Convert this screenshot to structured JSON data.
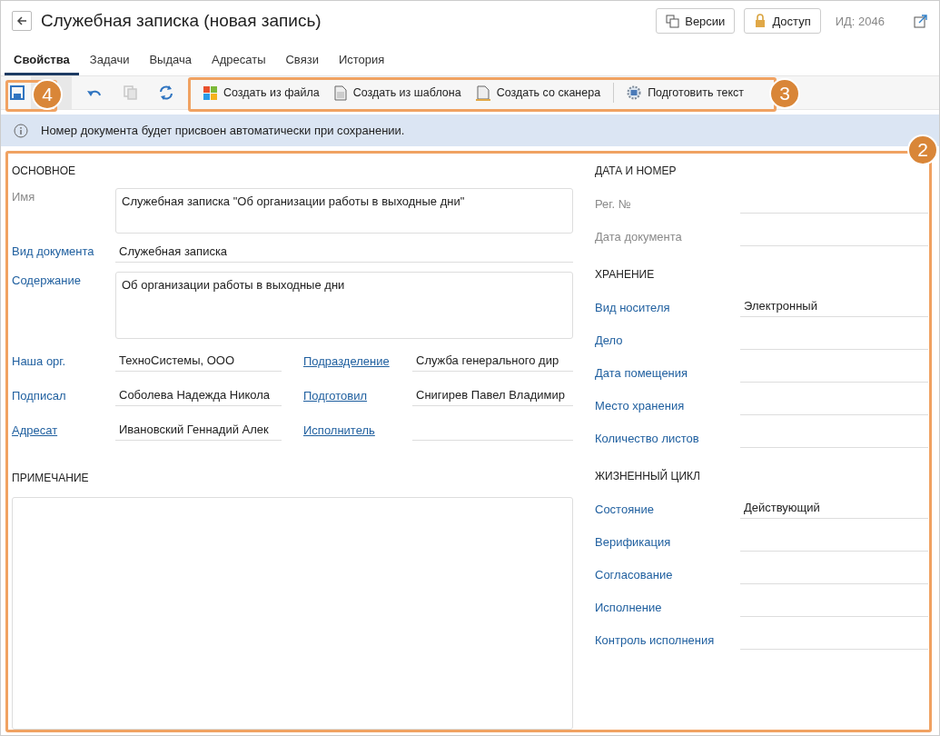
{
  "window": {
    "title": "Служебная записка (новая запись)",
    "id_label": "ИД: 2046"
  },
  "header_buttons": [
    {
      "label": "Версии",
      "kind": "versions"
    },
    {
      "label": "Доступ",
      "kind": "access"
    }
  ],
  "tabs": [
    {
      "label": "Свойства",
      "selected": true
    },
    {
      "label": "Задачи",
      "selected": false
    },
    {
      "label": "Выдача",
      "selected": false
    },
    {
      "label": "Адресаты",
      "selected": false
    },
    {
      "label": "Связи",
      "selected": false
    },
    {
      "label": "История",
      "selected": false
    }
  ],
  "toolbar": {
    "icons": [
      {
        "kind": "save",
        "disabled": false
      },
      {
        "kind": "undo",
        "disabled": false
      },
      {
        "kind": "copy",
        "disabled": true
      },
      {
        "kind": "refresh",
        "disabled": false
      }
    ],
    "actions": [
      {
        "label": "Создать из файла",
        "kind": "file"
      },
      {
        "label": "Создать из шаблона",
        "kind": "template"
      },
      {
        "label": "Создать со сканера",
        "kind": "scanner"
      },
      {
        "label": "Подготовить текст",
        "kind": "ai"
      }
    ]
  },
  "info": {
    "text": "Номер документа будет присвоен автоматически при сохранении."
  },
  "basic": {
    "title": "ОСНОВНОЕ",
    "fields": [
      {
        "label": "Имя",
        "kind": "plain",
        "multiline": true,
        "value": "Служебная записка \"Об организации работы в выходные дни\""
      },
      {
        "label": "Вид документа",
        "kind": "field",
        "multiline": false,
        "value": "Служебная записка"
      },
      {
        "label": "Содержание",
        "kind": "field",
        "multiline": true,
        "value": "Об организации работы в выходные дни"
      }
    ],
    "pairs": [
      [
        {
          "label": "Наша орг.",
          "kind": "field",
          "value": "ТехноСистемы, ООО"
        },
        {
          "label": "Подразделение",
          "kind": "link",
          "value": "Служба генерального дир"
        }
      ],
      [
        {
          "label": "Подписал",
          "kind": "field",
          "value": "Соболева Надежда Никола"
        },
        {
          "label": "Подготовил",
          "kind": "link",
          "value": "Снигирев Павел Владимир"
        }
      ],
      [
        {
          "label": "Адресат",
          "kind": "link",
          "value": "Ивановский Геннадий Алек"
        },
        {
          "label": "Исполнитель",
          "kind": "link"
        }
      ]
    ]
  },
  "note": {
    "title": "ПРИМЕЧАНИЕ"
  },
  "sections": [
    {
      "title": "ДАТА И НОМЕР",
      "fields": [
        {
          "label": "Рег. №",
          "kind": "plain"
        },
        {
          "label": "Дата документа",
          "kind": "plain"
        }
      ]
    },
    {
      "title": "ХРАНЕНИЕ",
      "fields": [
        {
          "label": "Вид носителя",
          "kind": "field",
          "value": "Электронный"
        },
        {
          "label": "Дело",
          "kind": "field"
        },
        {
          "label": "Дата помещения",
          "kind": "field"
        },
        {
          "label": "Место хранения",
          "kind": "field"
        },
        {
          "label": "Количество листов",
          "kind": "field"
        }
      ]
    },
    {
      "title": "ЖИЗНЕННЫЙ ЦИКЛ",
      "fields": [
        {
          "label": "Состояние",
          "kind": "field",
          "value": "Действующий"
        },
        {
          "label": "Верификация",
          "kind": "field"
        },
        {
          "label": "Согласование",
          "kind": "field"
        },
        {
          "label": "Исполнение",
          "kind": "field"
        },
        {
          "label": "Контроль исполнения",
          "kind": "field"
        }
      ]
    }
  ],
  "callouts": [
    {
      "number": "4",
      "kind": "save"
    },
    {
      "number": "3",
      "kind": "actions"
    },
    {
      "number": "2",
      "kind": "form"
    }
  ]
}
